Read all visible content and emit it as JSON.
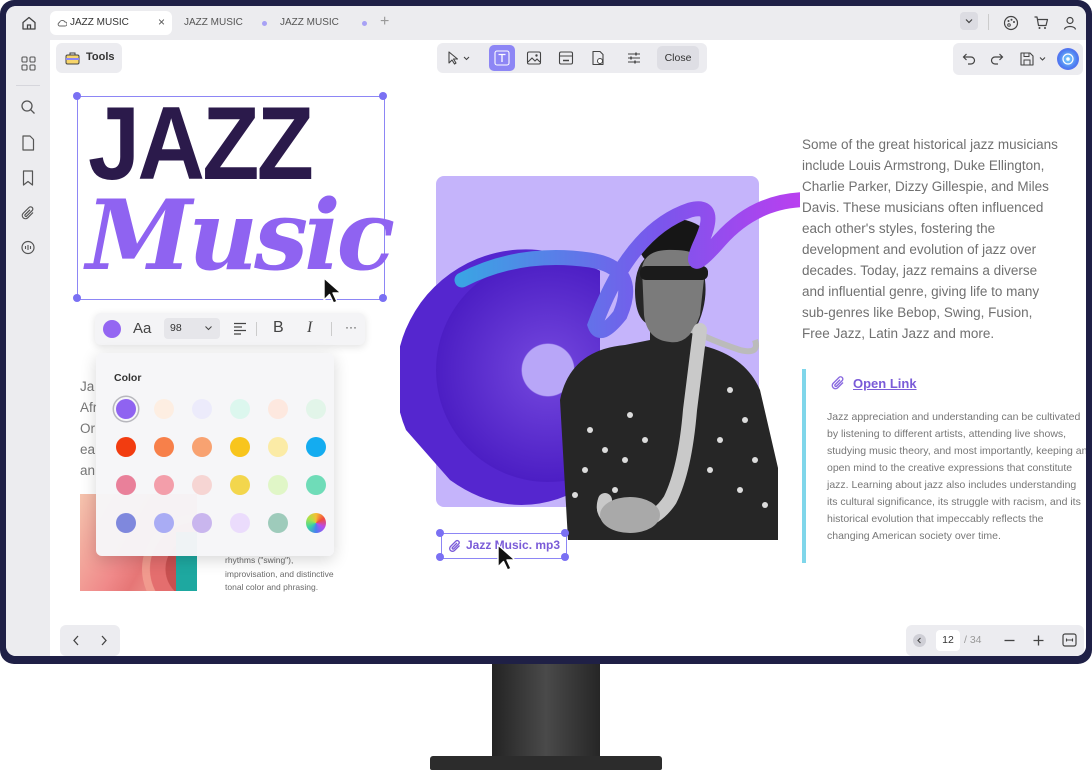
{
  "tabs": [
    {
      "label": "JAZZ MUSIC",
      "active": true
    },
    {
      "label": "JAZZ MUSIC",
      "active": false
    },
    {
      "label": "JAZZ MUSIC",
      "active": false
    }
  ],
  "toolbar": {
    "tools_label": "Tools",
    "close_label": "Close"
  },
  "title": {
    "line1": "JAZZ",
    "line2": "Music"
  },
  "text_format": {
    "font_size": "98",
    "font_icon_label": "Aa",
    "bold_label": "B",
    "italic_label": "I",
    "more_label": "···",
    "selected_color": "#8f63f1"
  },
  "color_panel": {
    "title": "Color",
    "swatches": [
      [
        "#8f63f1",
        "#fdeee2",
        "#ecebfb",
        "#dcf7ee",
        "#fde8df",
        "#e2f5e9"
      ],
      [
        "#f23c10",
        "#f7804a",
        "#f8a271",
        "#f8c51d",
        "#fbeba6",
        "#14acf0"
      ],
      [
        "#e9809a",
        "#f39eaa",
        "#f6d5d3",
        "#f3d64d",
        "#e0f6c7",
        "#6fdcb8"
      ],
      [
        "#7f88dd",
        "#a9acf4",
        "#c9b6ee",
        "#ebdcfc",
        "#9ecbbb",
        "rainbow"
      ]
    ]
  },
  "left_column": {
    "hidden_lines": [
      "Ja",
      "Afr",
      "Or",
      "ea",
      "an"
    ],
    "caption_lines": [
      "rhythms (\"swing\"),",
      "improvisation, and distinctive",
      "tonal color and phrasing."
    ]
  },
  "attachment": {
    "label": "Jazz Music. mp3"
  },
  "right_column": {
    "paragraph": "Some of the great historical jazz musicians include Louis Armstrong, Duke Ellington, Charlie Parker, Dizzy Gillespie, and Miles Davis. These musicians often influenced each other's styles, fostering the development and evolution of jazz over decades. Today, jazz remains a diverse and influential genre, giving life to many sub-genres like Bebop, Swing, Fusion, Free Jazz, Latin Jazz and more.",
    "link_label": "Open Link",
    "quote": "Jazz appreciation and understanding can be cultivated by listening to different artists, attending live shows, studying music theory, and most importantly, keeping an open mind to the creative expressions that constitute jazz. Learning about jazz also includes understanding its cultural significance, its struggle with racism, and its historical evolution that impeccably reflects the changing American society over time."
  },
  "pagination": {
    "current": "12",
    "total": "/ 34"
  },
  "colors": {
    "accent": "#8d86f5",
    "title_dark": "#2b1a4b",
    "title_purple": "#8f63f1",
    "quote_bar": "#7fd6ea",
    "link": "#7a5bd8"
  }
}
